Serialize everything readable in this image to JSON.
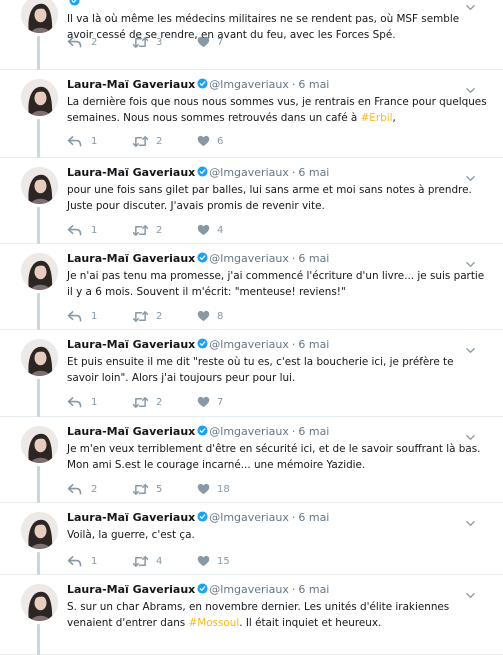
{
  "colors": {
    "hashtag": "#fab81e",
    "verified": "#1da1f2",
    "muted": "#657786",
    "icon": "#8899a6",
    "thread_line": "#ccd6dd",
    "divider": "#e6ecf0"
  },
  "icons": {
    "reply": "reply-icon",
    "retweet": "retweet-icon",
    "like": "heart-icon",
    "menu": "chevron-down-icon",
    "verified": "verified-badge-icon"
  },
  "tweets": [
    {
      "name": "",
      "handle": "",
      "sep": "",
      "time": "",
      "text_parts": [
        "Il va là où même les médecins militaires ne se rendent pas, où MSF semble avoir cessé de se rendre, en avant du feu, avec les Forces Spé."
      ],
      "replies": "2",
      "retweets": "3",
      "likes": "7"
    },
    {
      "name": "Laura-Maï Gaveriaux",
      "handle": "@lmgaveriaux",
      "sep": "·",
      "time": "6 mai",
      "text_parts": [
        "La dernière fois que nous nous sommes vus, je rentrais en France pour quelques semaines. Nous nous sommes retrouvés dans un café à ",
        "#Erbil",
        ","
      ],
      "replies": "1",
      "retweets": "2",
      "likes": "6"
    },
    {
      "name": "Laura-Maï Gaveriaux",
      "handle": "@lmgaveriaux",
      "sep": "·",
      "time": "6 mai",
      "text_parts": [
        "pour une fois sans gilet par balles, lui sans arme et moi sans notes à prendre. Juste pour discuter. J'avais promis de revenir vite."
      ],
      "replies": "1",
      "retweets": "2",
      "likes": "4"
    },
    {
      "name": "Laura-Maï Gaveriaux",
      "handle": "@lmgaveriaux",
      "sep": "·",
      "time": "6 mai",
      "text_parts": [
        "Je n'ai pas tenu ma promesse, j'ai commencé l'écriture d'un livre... je suis partie il y a 6 mois. Souvent il m'écrit: \"menteuse! reviens!\""
      ],
      "replies": "1",
      "retweets": "2",
      "likes": "8"
    },
    {
      "name": "Laura-Maï Gaveriaux",
      "handle": "@lmgaveriaux",
      "sep": "·",
      "time": "6 mai",
      "text_parts": [
        "Et puis ensuite il me dit \"reste où tu es, c'est la boucherie ici, je préfère te savoir loin\". Alors j'ai toujours peur pour lui."
      ],
      "replies": "1",
      "retweets": "2",
      "likes": "7"
    },
    {
      "name": "Laura-Maï Gaveriaux",
      "handle": "@lmgaveriaux",
      "sep": "·",
      "time": "6 mai",
      "text_parts": [
        "Je m'en veux terriblement d'être en sécurité ici, et de le savoir souffrant là bas. Mon ami S.est le courage incarné... une mémoire Yazidie."
      ],
      "replies": "2",
      "retweets": "5",
      "likes": "18"
    },
    {
      "name": "Laura-Maï Gaveriaux",
      "handle": "@lmgaveriaux",
      "sep": "·",
      "time": "6 mai",
      "text_parts": [
        "Voilà, la guerre, c'est ça."
      ],
      "replies": "1",
      "retweets": "4",
      "likes": "15"
    },
    {
      "name": "Laura-Maï Gaveriaux",
      "handle": "@lmgaveriaux",
      "sep": "·",
      "time": "6 mai",
      "text_parts": [
        "S. sur un char Abrams, en novembre dernier. Les unités d'élite irakiennes venaient d'entrer dans ",
        "#Mossoul",
        ". Il était inquiet et heureux."
      ],
      "replies": "",
      "retweets": "",
      "likes": ""
    }
  ]
}
